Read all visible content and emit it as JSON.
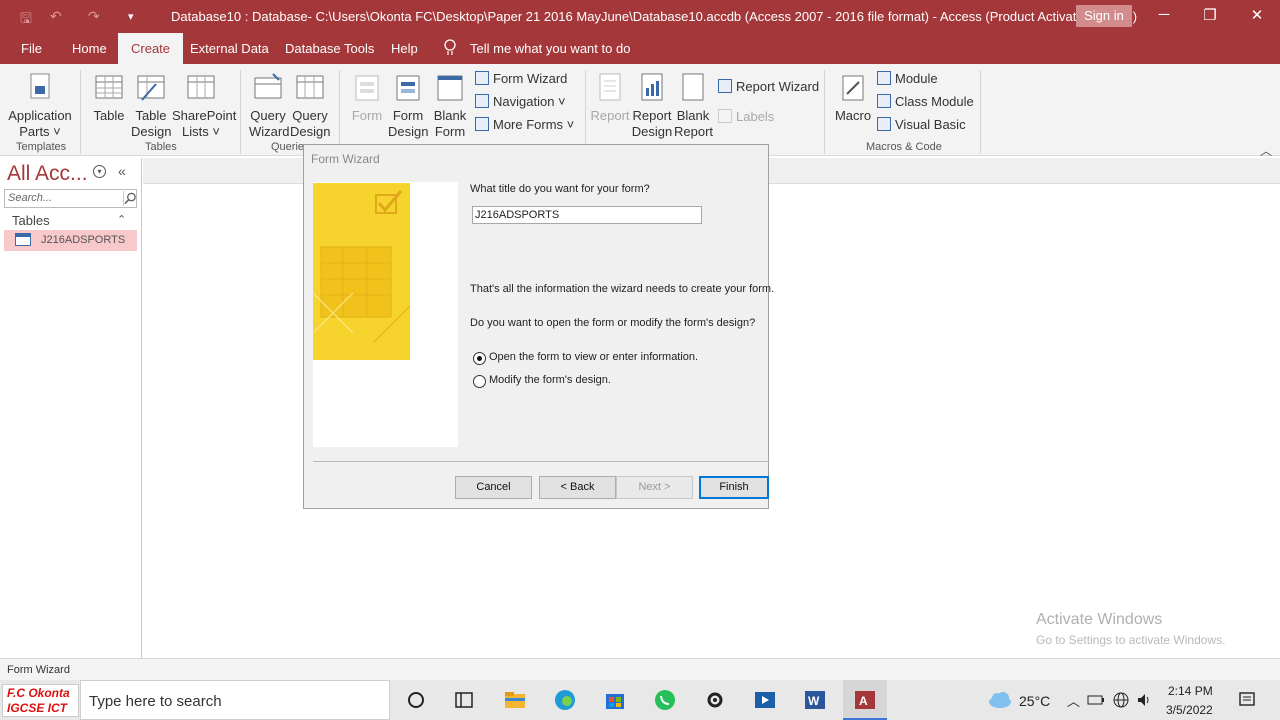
{
  "window": {
    "title": "Database10 : Database- C:\\Users\\Okonta FC\\Desktop\\Paper 21 2016 MayJune\\Database10.accdb (Access 2007 - 2016 file format)  -  Access (Product Activation Failed)",
    "sign_in": "Sign in",
    "qat": {
      "save": "🖫",
      "undo": "↶",
      "redo": "↷",
      "customize": "▾"
    },
    "controls": {
      "minimize": "─",
      "restore": "❐",
      "close": "✕"
    }
  },
  "tabs": [
    {
      "label": "File"
    },
    {
      "label": "Home"
    },
    {
      "label": "Create"
    },
    {
      "label": "External Data"
    },
    {
      "label": "Database Tools"
    },
    {
      "label": "Help"
    }
  ],
  "tell_me": "Tell me what you want to do",
  "ribbon": {
    "application_parts": "Application\nParts ˅",
    "table": "Table",
    "table_design": "Table\nDesign",
    "sharepoint_lists": "SharePoint\nLists ˅",
    "query_wizard": "Query\nWizard",
    "query_design": "Query\nDesign",
    "form": "Form",
    "form_design": "Form\nDesign",
    "blank_form": "Blank\nForm",
    "form_wizard": "Form Wizard",
    "navigation": "Navigation ˅",
    "more_forms": "More Forms ˅",
    "report": "Report",
    "report_design": "Report\nDesign",
    "blank_report": "Blank\nReport",
    "report_wizard": "Report Wizard",
    "labels": "Labels",
    "macro": "Macro",
    "module": "Module",
    "class_module": "Class Module",
    "visual_basic": "Visual Basic",
    "groups": {
      "templates": "Templates",
      "tables": "Tables",
      "queries": "Querie",
      "macros_code": "Macros & Code"
    }
  },
  "nav_pane": {
    "header": "All Acc...",
    "search_placeholder": "Search...",
    "group": "Tables",
    "items": [
      {
        "label": "J216ADSPORTS"
      }
    ]
  },
  "dialog": {
    "title": "Form Wizard",
    "question": "What title do you want for your form?",
    "form_title_value": "J216ADSPORTS",
    "info": "That's all the information the wizard needs to create your form.",
    "open_or_modify": "Do you want to open the form or modify the form's design?",
    "option_open": "Open the form to view or enter information.",
    "option_open_selected": true,
    "option_modify": "Modify the form's design.",
    "buttons": {
      "cancel": "Cancel",
      "back": "< Back",
      "next": "Next >",
      "finish": "Finish"
    }
  },
  "watermark": {
    "line1": "Activate Windows",
    "line2": "Go to Settings to activate Windows."
  },
  "status_bar": "Form Wizard",
  "taskbar": {
    "logo_line1": "F.C Okonta",
    "logo_line2": "IGCSE ICT",
    "search_placeholder": "Type here to search",
    "weather": "25°C",
    "time": "2:14 PM",
    "date": "3/5/2022"
  }
}
